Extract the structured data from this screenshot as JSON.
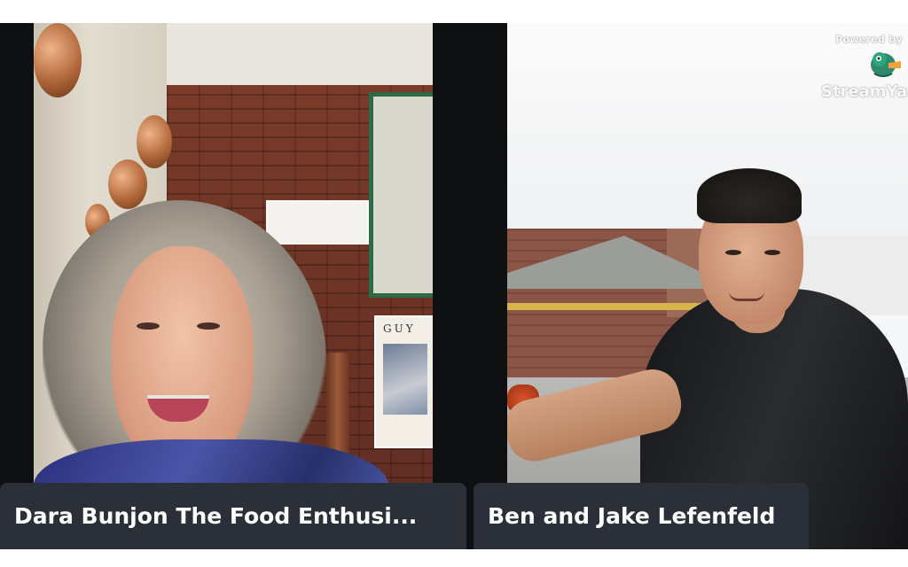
{
  "participants": [
    {
      "display_name": "Dara Bunjon The Food Enthusi...",
      "position": "left"
    },
    {
      "display_name": "Ben and Jake Lefenfeld",
      "position": "right"
    }
  ],
  "watermark": {
    "powered_text": "Powered by",
    "brand_name": "StreamYard",
    "logo_icon": "duck-logo-icon"
  },
  "colors": {
    "label_bg": "#2b3038",
    "label_text": "#ffffff",
    "tile_border": "#0f1012"
  }
}
